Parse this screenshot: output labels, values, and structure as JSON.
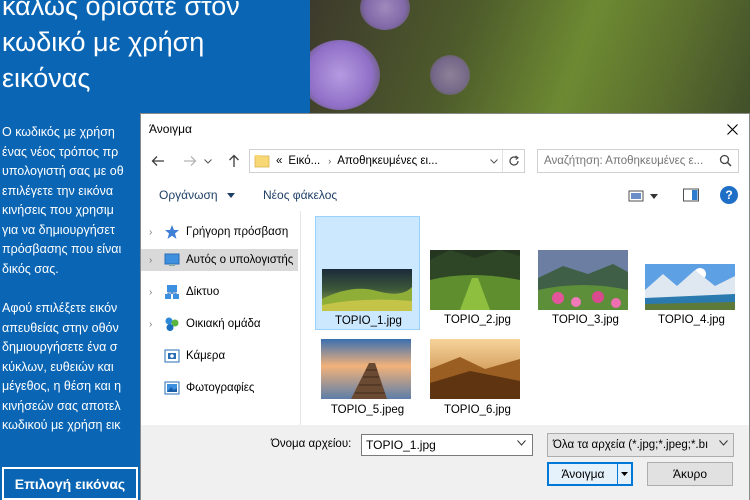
{
  "background": {
    "title_lines": [
      "καλώς ορίσατε στον",
      "κωδικό με χρήση",
      "εικόνας"
    ],
    "para1_lines": [
      "Ο κωδικός με χρήση",
      "ένας νέος τρόπος πρ",
      "υπολογιστή σας με οθ",
      "επιλέγετε την εικόνα",
      "κινήσεις που χρησιμ",
      "για να δημιουργήσετ",
      "πρόσβασης που είναι",
      "δικός σας."
    ],
    "para2_lines": [
      "Αφού επιλέξετε εικόν",
      "απευθείας στην οθόν",
      "δημιουργήσετε ένα σ",
      "κύκλων, ευθειών και",
      "μέγεθος, η θέση και η",
      "κινήσεών σας αποτελ",
      "κωδικού με χρήση εικ"
    ],
    "choose_picture_button": "Επιλογή εικόνας"
  },
  "dialog": {
    "title": "Άνοιγμα",
    "address": {
      "overflow": "«",
      "crumbs": [
        "Εικό...",
        "Αποθηκευμένες ει..."
      ]
    },
    "search_placeholder": "Αναζήτηση: Αποθηκευμένες ε...",
    "toolbar": {
      "organize": "Οργάνωση",
      "new_folder": "Νέος φάκελος"
    },
    "nav_items": [
      {
        "label": "Γρήγορη πρόσβαση",
        "icon": "star-icon",
        "selected": false
      },
      {
        "label": "Αυτός ο υπολογιστής",
        "icon": "computer-icon",
        "selected": true
      },
      {
        "label": "Δίκτυο",
        "icon": "network-icon",
        "selected": false
      },
      {
        "label": "Οικιακή ομάδα",
        "icon": "homegroup-icon",
        "selected": false
      },
      {
        "label": "Κάμερα",
        "icon": "camera-folder-icon",
        "selected": false
      },
      {
        "label": "Φωτογραφίες",
        "icon": "pictures-folder-icon",
        "selected": false
      }
    ],
    "files": [
      {
        "name": "TOPIO_1.jpg",
        "selected": true
      },
      {
        "name": "TOPIO_2.jpg",
        "selected": false
      },
      {
        "name": "TOPIO_3.jpg",
        "selected": false
      },
      {
        "name": "TOPIO_4.jpg",
        "selected": false
      },
      {
        "name": "TOPIO_5.jpeg",
        "selected": false
      },
      {
        "name": "TOPIO_6.jpg",
        "selected": false
      }
    ],
    "filename_label": "Όνομα αρχείου:",
    "filename_value": "TOPIO_1.jpg",
    "filetype_value": "Όλα τα αρχεία (*.jpg;*.jpeg;*.bı",
    "open_button": "Άνοιγμα",
    "cancel_button": "Άκυρο"
  },
  "colors": {
    "accent": "#0078d7",
    "background_blue": "#0a66b5",
    "selection": "#cce8ff"
  }
}
